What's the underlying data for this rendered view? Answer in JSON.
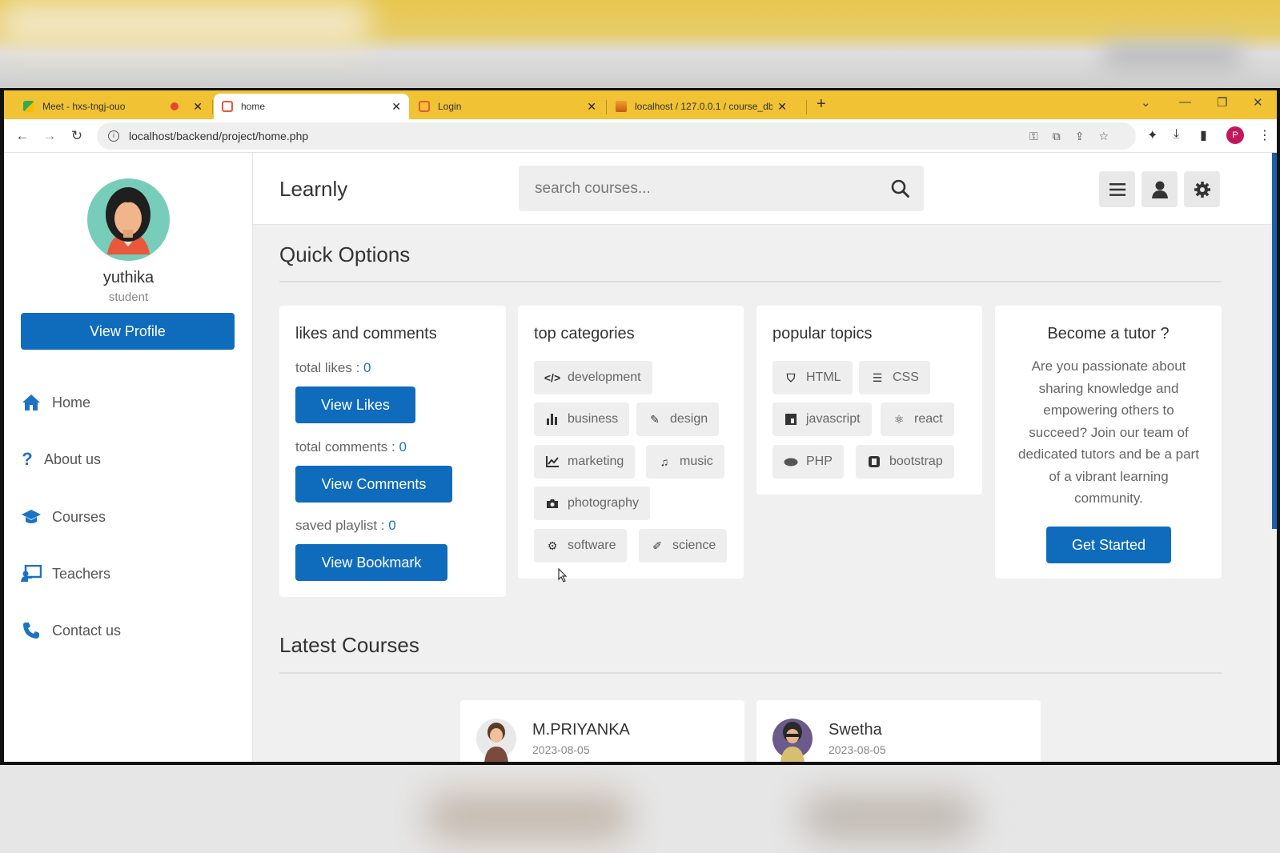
{
  "browser": {
    "tabs": [
      {
        "title": "Meet - hxs-tngj-ouo",
        "active": false
      },
      {
        "title": "home",
        "active": true
      },
      {
        "title": "Login",
        "active": false
      },
      {
        "title": "localhost / 127.0.0.1 / course_db",
        "active": false
      }
    ],
    "new_tab": "+",
    "url": "localhost/backend/project/home.php",
    "profile_initial": "P"
  },
  "sidebar": {
    "username": "yuthika",
    "role": "student",
    "view_profile": "View Profile",
    "nav": [
      {
        "label": "Home",
        "icon": "home-icon"
      },
      {
        "label": "About us",
        "icon": "question-icon"
      },
      {
        "label": "Courses",
        "icon": "graduation-cap-icon"
      },
      {
        "label": "Teachers",
        "icon": "chalkboard-teacher-icon"
      },
      {
        "label": "Contact us",
        "icon": "phone-icon"
      }
    ]
  },
  "header": {
    "logo": "Learnly",
    "search_placeholder": "search courses..."
  },
  "quick_options": {
    "title": "Quick Options",
    "likes_card": {
      "title": "likes and comments",
      "likes_label": "total likes : ",
      "likes_value": "0",
      "view_likes": "View Likes",
      "comments_label": "total comments : ",
      "comments_value": "0",
      "view_comments": "View Comments",
      "playlist_label": "saved playlist : ",
      "playlist_value": "0",
      "view_bookmark": "View Bookmark"
    },
    "categories_card": {
      "title": "top categories",
      "tags": [
        {
          "label": "development",
          "icon": "code-icon"
        },
        {
          "label": "business",
          "icon": "bar-chart-icon"
        },
        {
          "label": "design",
          "icon": "pen-icon"
        },
        {
          "label": "marketing",
          "icon": "line-chart-icon"
        },
        {
          "label": "music",
          "icon": "music-icon"
        },
        {
          "label": "photography",
          "icon": "camera-icon"
        },
        {
          "label": "software",
          "icon": "cog-icon"
        },
        {
          "label": "science",
          "icon": "vial-icon"
        }
      ]
    },
    "topics_card": {
      "title": "popular topics",
      "tags": [
        {
          "label": "HTML",
          "icon": "html5-icon"
        },
        {
          "label": "CSS",
          "icon": "css3-icon"
        },
        {
          "label": "javascript",
          "icon": "js-icon"
        },
        {
          "label": "react",
          "icon": "react-icon"
        },
        {
          "label": "PHP",
          "icon": "php-icon"
        },
        {
          "label": "bootstrap",
          "icon": "bootstrap-icon"
        }
      ]
    },
    "tutor_card": {
      "title": "Become a tutor ?",
      "text": "Are you passionate about sharing knowledge and empowering others to succeed? Join our team of dedicated tutors and be a part of a vibrant learning community.",
      "button": "Get Started"
    }
  },
  "latest_courses": {
    "title": "Latest Courses",
    "courses": [
      {
        "tutor": "M.PRIYANKA",
        "date": "2023-08-05"
      },
      {
        "tutor": "Swetha",
        "date": "2023-08-05"
      }
    ]
  },
  "colors": {
    "accent": "#0f6cbd",
    "tab_bar": "#f1c233",
    "link_blue": "#1b73c2"
  }
}
